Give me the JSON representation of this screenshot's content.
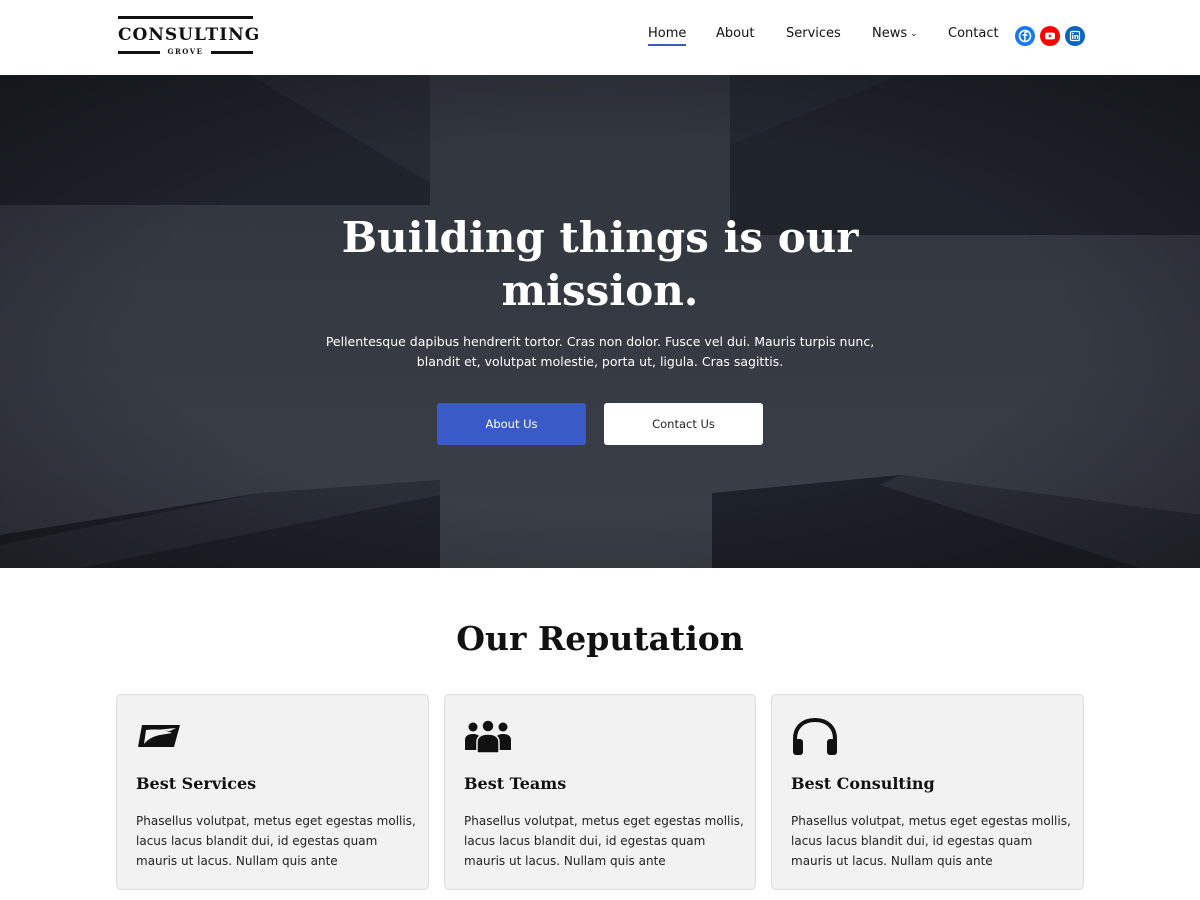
{
  "header": {
    "logo": {
      "text": "CONSULTING",
      "subtext": "GROVE"
    },
    "nav": [
      {
        "label": "Home",
        "active": true
      },
      {
        "label": "About"
      },
      {
        "label": "Services"
      },
      {
        "label": "News",
        "has_dropdown": true
      },
      {
        "label": "Contact"
      }
    ],
    "social": [
      {
        "icon": "facebook-icon",
        "color": "#1877f2"
      },
      {
        "icon": "youtube-icon",
        "color": "#ff0000"
      },
      {
        "icon": "linkedin-icon",
        "color": "#0a66c2"
      }
    ]
  },
  "hero": {
    "title": "Building things is our mission.",
    "text": "Pellentesque dapibus hendrerit tortor. Cras non dolor. Fusce vel dui. Mauris turpis nunc, blandit et, volutpat molestie, porta ut, ligula. Cras sagittis.",
    "primary_button": "About Us",
    "secondary_button": "Contact Us"
  },
  "reputation": {
    "title": "Our Reputation",
    "cards": [
      {
        "icon": "postal-eagle-icon",
        "title": "Best Services",
        "text": "Phasellus volutpat, metus eget egestas mollis, lacus lacus blandit dui, id egestas quam mauris ut lacus. Nullam quis ante"
      },
      {
        "icon": "team-icon",
        "title": "Best Teams",
        "text": "Phasellus volutpat, metus eget egestas mollis, lacus lacus blandit dui, id egestas quam mauris ut lacus. Nullam quis ante"
      },
      {
        "icon": "headphones-icon",
        "title": "Best Consulting",
        "text": "Phasellus volutpat, metus eget egestas mollis, lacus lacus blandit dui, id egestas quam mauris ut lacus. Nullam quis ante"
      }
    ]
  },
  "colors": {
    "accent": "#3a5bc7",
    "hero_bg": "#262a33",
    "card_bg": "#f2f2f2"
  }
}
